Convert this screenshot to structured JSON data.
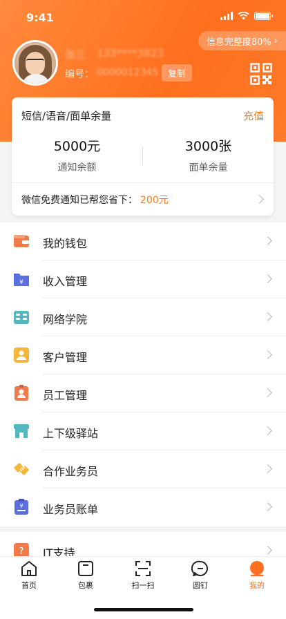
{
  "status_bar": {
    "time": "9:41"
  },
  "profile": {
    "completeness": "信息完整度80%",
    "name": "张三",
    "phone": "133****3823",
    "id_label": "编号：",
    "id_value": "0000012345",
    "copy_label": "复制"
  },
  "balance_card": {
    "title": "短信/语音/面单余量",
    "recharge_label": "充值",
    "notify_value": "5000元",
    "notify_label": "通知余额",
    "waybill_value": "3000张",
    "waybill_label": "面单余量",
    "wechat_text": "微信免费通知已帮您省下：",
    "wechat_amount": "200元"
  },
  "menu": {
    "items": [
      {
        "label": "我的钱包",
        "icon": "wallet-icon",
        "color": "#f07a4a"
      },
      {
        "label": "收入管理",
        "icon": "income-folder-icon",
        "color": "#5b6fe0"
      },
      {
        "label": "网络学院",
        "icon": "book-icon",
        "color": "#4fb8c0"
      },
      {
        "label": "客户管理",
        "icon": "customer-icon",
        "color": "#f5b43a"
      },
      {
        "label": "员工管理",
        "icon": "employee-badge-icon",
        "color": "#f07a4a"
      },
      {
        "label": "上下级驿站",
        "icon": "station-store-icon",
        "color": "#4fb8c0"
      },
      {
        "label": "合作业务员",
        "icon": "handshake-icon",
        "color": "#f5b43a"
      },
      {
        "label": "业务员账单",
        "icon": "bill-icon",
        "color": "#5b6fe0"
      }
    ],
    "partial_item": {
      "label": "IT支持",
      "icon": "support-icon",
      "color": "#f07a4a"
    }
  },
  "tabbar": {
    "tabs": [
      {
        "label": "首页",
        "icon": "home-icon"
      },
      {
        "label": "包裹",
        "icon": "package-icon"
      },
      {
        "label": "扫一扫",
        "icon": "scan-icon"
      },
      {
        "label": "圆钉",
        "icon": "chat-icon"
      },
      {
        "label": "我的",
        "icon": "profile-icon"
      }
    ],
    "active_index": 4
  },
  "colors": {
    "accent": "#ff6f1e",
    "header_gradient": [
      "#ff8a3c",
      "#ff6f1e"
    ]
  }
}
